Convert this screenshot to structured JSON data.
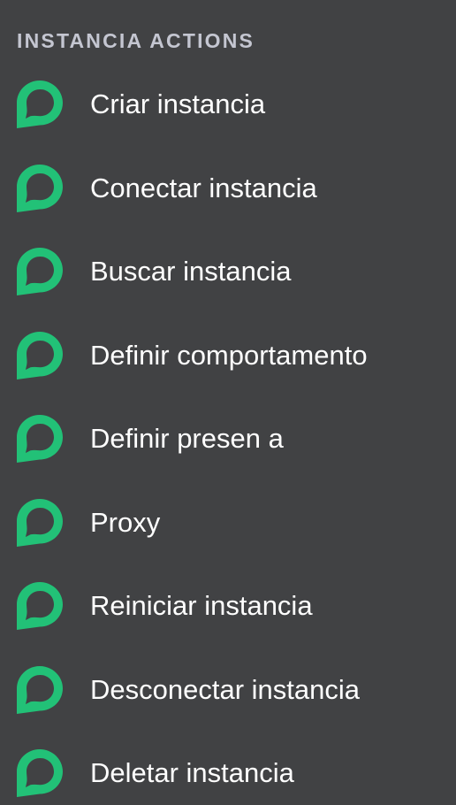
{
  "section": {
    "title": "INSTANCIA ACTIONS"
  },
  "colors": {
    "background": "#414244",
    "title": "#c4c6d1",
    "icon": "#22c177",
    "label": "#ffffff"
  },
  "icon_name": "chat-bubble-icon",
  "actions": [
    {
      "label": "Criar instancia"
    },
    {
      "label": "Conectar instancia"
    },
    {
      "label": "Buscar instancia"
    },
    {
      "label": "Definir comportamento"
    },
    {
      "label": "Definir presen a"
    },
    {
      "label": "Proxy"
    },
    {
      "label": "Reiniciar instancia"
    },
    {
      "label": "Desconectar instancia"
    },
    {
      "label": "Deletar instancia"
    }
  ]
}
